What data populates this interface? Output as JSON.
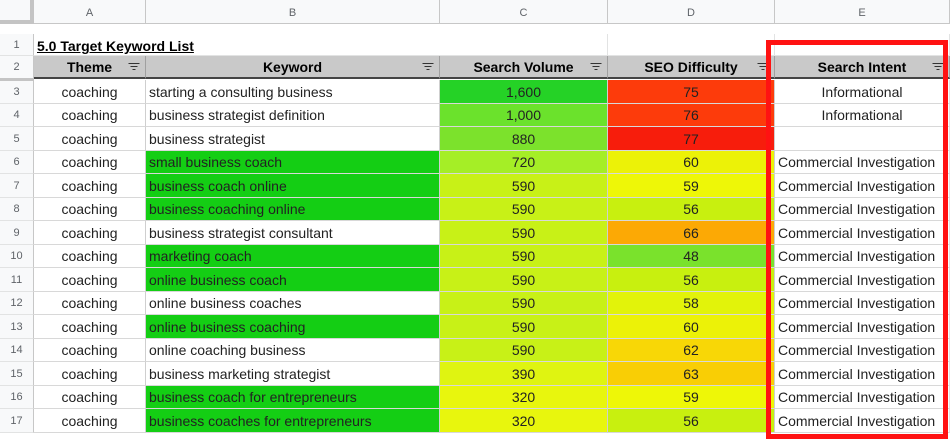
{
  "column_headers": [
    "A",
    "B",
    "C",
    "D",
    "E"
  ],
  "sheet_title": "5.0 Target Keyword List",
  "table_headers": [
    "Theme",
    "Keyword",
    "Search Volume",
    "SEO Difficulty",
    "Search Intent"
  ],
  "rows": [
    {
      "row": "3",
      "theme": "coaching",
      "keyword": "starting a consulting business",
      "volume": "1,600",
      "difficulty": "75",
      "intent": "Informational",
      "kw_color": "#ffffff",
      "vol_color": "#25d226",
      "diff_color": "#fd3b0b"
    },
    {
      "row": "4",
      "theme": "coaching",
      "keyword": "business strategist definition",
      "volume": "1,000",
      "difficulty": "76",
      "intent": "Informational",
      "kw_color": "#ffffff",
      "vol_color": "#6be22c",
      "diff_color": "#fd3b0b"
    },
    {
      "row": "5",
      "theme": "coaching",
      "keyword": "business strategist",
      "volume": "880",
      "difficulty": "77",
      "intent": "",
      "kw_color": "#ffffff",
      "vol_color": "#7ce22c",
      "diff_color": "#f71d0c"
    },
    {
      "row": "6",
      "theme": "coaching",
      "keyword": "small business coach",
      "volume": "720",
      "difficulty": "60",
      "intent": "Commercial Investigation",
      "kw_color": "#14ce14",
      "vol_color": "#a5ee26",
      "diff_color": "#ecf207"
    },
    {
      "row": "7",
      "theme": "coaching",
      "keyword": "business coach online",
      "volume": "590",
      "difficulty": "59",
      "intent": "Commercial Investigation",
      "kw_color": "#14ce14",
      "vol_color": "#c8f117",
      "diff_color": "#eef707"
    },
    {
      "row": "8",
      "theme": "coaching",
      "keyword": "business coaching online",
      "volume": "590",
      "difficulty": "56",
      "intent": "Commercial Investigation",
      "kw_color": "#14ce14",
      "vol_color": "#c8f117",
      "diff_color": "#c8f00f"
    },
    {
      "row": "9",
      "theme": "coaching",
      "keyword": "business strategist consultant",
      "volume": "590",
      "difficulty": "66",
      "intent": "Commercial Investigation",
      "kw_color": "#ffffff",
      "vol_color": "#c8f117",
      "diff_color": "#fca905"
    },
    {
      "row": "10",
      "theme": "coaching",
      "keyword": "marketing coach",
      "volume": "590",
      "difficulty": "48",
      "intent": "Commercial Investigation",
      "kw_color": "#14ce14",
      "vol_color": "#c8f117",
      "diff_color": "#7ae22c"
    },
    {
      "row": "11",
      "theme": "coaching",
      "keyword": "online business coach",
      "volume": "590",
      "difficulty": "56",
      "intent": "Commercial Investigation",
      "kw_color": "#14ce14",
      "vol_color": "#c8f117",
      "diff_color": "#c8f00f"
    },
    {
      "row": "12",
      "theme": "coaching",
      "keyword": "online business coaches",
      "volume": "590",
      "difficulty": "58",
      "intent": "Commercial Investigation",
      "kw_color": "#ffffff",
      "vol_color": "#c8f117",
      "diff_color": "#e2f30a"
    },
    {
      "row": "13",
      "theme": "coaching",
      "keyword": "online business coaching",
      "volume": "590",
      "difficulty": "60",
      "intent": "Commercial Investigation",
      "kw_color": "#14ce14",
      "vol_color": "#c8f117",
      "diff_color": "#ecf207"
    },
    {
      "row": "14",
      "theme": "coaching",
      "keyword": "online coaching business",
      "volume": "590",
      "difficulty": "62",
      "intent": "Commercial Investigation",
      "kw_color": "#ffffff",
      "vol_color": "#c8f117",
      "diff_color": "#f8d706"
    },
    {
      "row": "15",
      "theme": "coaching",
      "keyword": "business marketing strategist",
      "volume": "390",
      "difficulty": "63",
      "intent": "Commercial Investigation",
      "kw_color": "#ffffff",
      "vol_color": "#dff411",
      "diff_color": "#f9ce05"
    },
    {
      "row": "16",
      "theme": "coaching",
      "keyword": "business coach for entrepreneurs",
      "volume": "320",
      "difficulty": "59",
      "intent": "Commercial Investigation",
      "kw_color": "#14ce14",
      "vol_color": "#e8f60d",
      "diff_color": "#eef707"
    },
    {
      "row": "17",
      "theme": "coaching",
      "keyword": "business coaches for entrepreneurs",
      "volume": "320",
      "difficulty": "56",
      "intent": "Commercial Investigation",
      "kw_color": "#14ce14",
      "vol_color": "#e8f60d",
      "diff_color": "#c8f00f"
    }
  ],
  "colors": {
    "header_fill": "#c9c9c9",
    "highlight_border": "#ff1212",
    "grid_line": "#e2e3e3"
  }
}
